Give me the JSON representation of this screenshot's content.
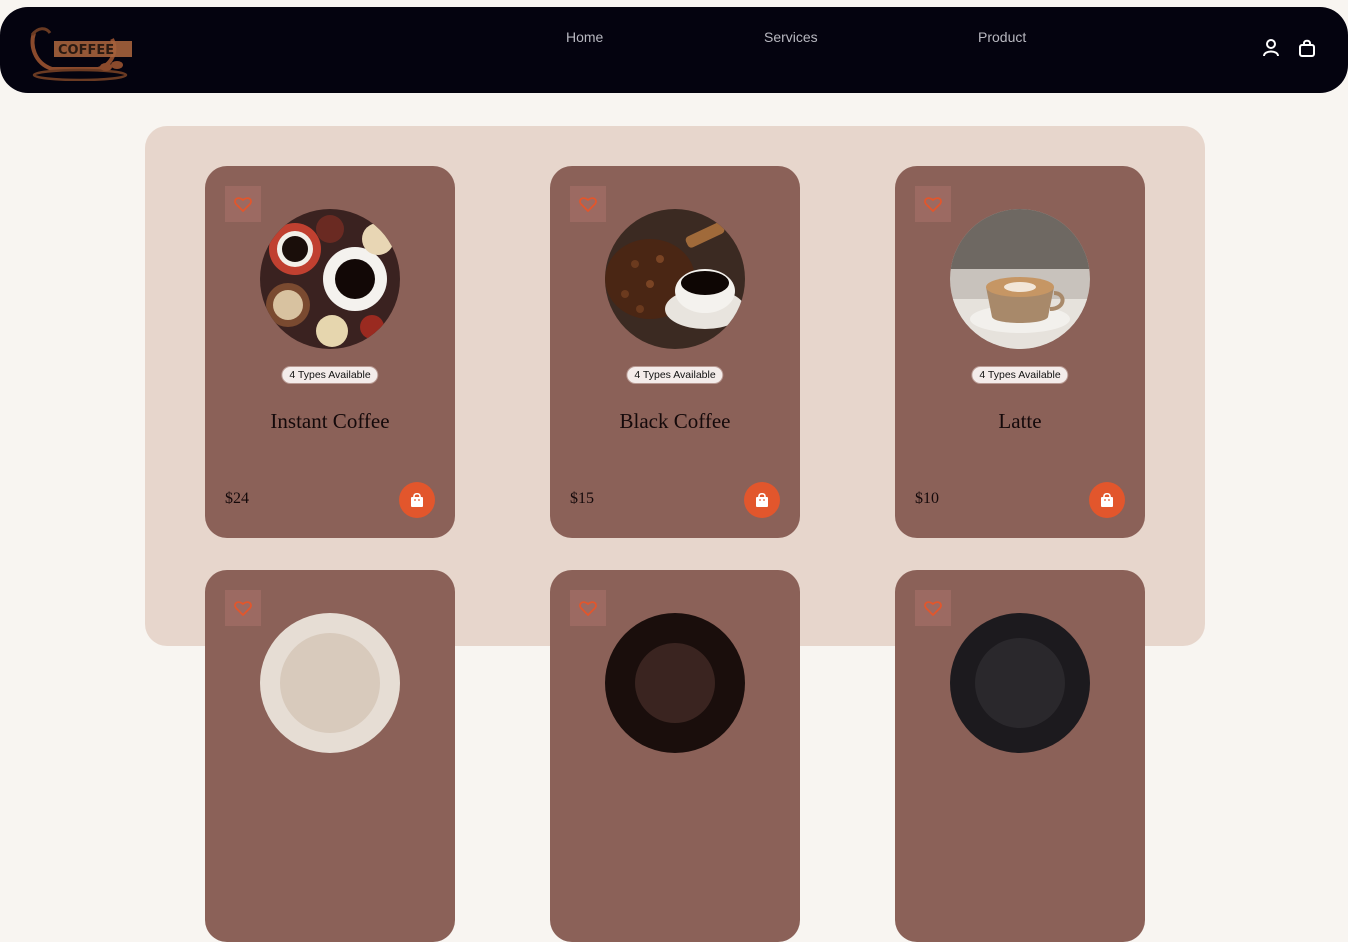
{
  "nav": {
    "logo_text": "COFFEE",
    "links": [
      "Home",
      "Services",
      "Product"
    ],
    "icons": [
      "user-icon",
      "shopping-bag-icon"
    ]
  },
  "products": [
    {
      "name": "Instant Coffee",
      "badge": "4 Types Available",
      "price": "$24",
      "image": "instant-coffee-photo"
    },
    {
      "name": "Black Coffee",
      "badge": "4 Types Available",
      "price": "$15",
      "image": "black-coffee-photo"
    },
    {
      "name": "Latte",
      "badge": "4 Types Available",
      "price": "$10",
      "image": "latte-photo"
    },
    {
      "name": "",
      "badge": "",
      "price": "",
      "image": "coffee-photo"
    },
    {
      "name": "",
      "badge": "",
      "price": "",
      "image": "coffee-photo"
    },
    {
      "name": "",
      "badge": "",
      "price": "",
      "image": "coffee-photo"
    }
  ],
  "colors": {
    "navbar": "#04030f",
    "page_bg": "#f8f5f1",
    "panel_bg": "#e7d6cc",
    "card_bg": "#8b6158",
    "accent": "#e2562c"
  }
}
